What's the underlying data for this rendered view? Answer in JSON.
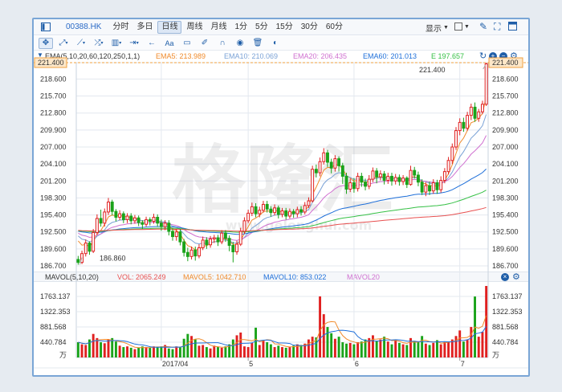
{
  "toolbar": {
    "symbol": "00388.HK",
    "periods": [
      "分时",
      "多日",
      "日线",
      "周线",
      "月线",
      "1分",
      "5分",
      "15分",
      "30分",
      "60分"
    ],
    "active_period": "日线",
    "display_label": "显示"
  },
  "price_legend": {
    "params": "EMA(5,10,20,60,120,250,1,1)",
    "ema5": "EMA5: 213.989",
    "ema10": "EMA10: 210.069",
    "ema20": "EMA20: 206.435",
    "ema60": "EMA60: 201.013",
    "ema120": "E 197.657"
  },
  "volume_legend": {
    "params": "MAVOL(5,10,20)",
    "vol": "VOL: 2065.249",
    "mavol5": "MAVOL5: 1042.710",
    "mavol10": "MAVOL10: 853.022",
    "mavol20": "MAVOL20"
  },
  "watermark": {
    "brand": "格隆汇",
    "url": "www.gelonghui.com"
  },
  "colors": {
    "up": "#e02020",
    "down": "#1aa31a",
    "ema5": "#f08a2a",
    "ema10": "#7aa2d6",
    "ema20": "#d070d0",
    "ema60": "#1e6fd9",
    "ema120": "#35c045",
    "ema250": "#e85050",
    "accent": "#1f5ea8"
  },
  "price_axis": {
    "ticks": [
      "221.400",
      "218.600",
      "215.700",
      "212.800",
      "209.900",
      "207.000",
      "204.100",
      "201.200",
      "198.300",
      "195.400",
      "192.500",
      "189.600",
      "186.700"
    ],
    "current": "221.400",
    "min": 186.7,
    "max": 221.4
  },
  "annotations": {
    "high": "221.400",
    "low": "186.860"
  },
  "volume_axis": {
    "ticks": [
      "1763.137",
      "1322.353",
      "881.568",
      "440.784"
    ],
    "unit": "万",
    "max": 2065
  },
  "date_axis": {
    "labels": [
      "2017/04",
      "5",
      "6",
      "7"
    ],
    "label_index": [
      22,
      45,
      73,
      101
    ]
  },
  "chart_data": {
    "type": "candlestick",
    "title": "",
    "ylabel": "",
    "ylim": [
      186.7,
      221.4
    ],
    "candles": [
      [
        187.8,
        187.3,
        188.4,
        186.9
      ],
      [
        187.3,
        188.8,
        189.3,
        187.0
      ],
      [
        188.8,
        190.6,
        191.2,
        188.3
      ],
      [
        190.6,
        189.2,
        190.9,
        188.6
      ],
      [
        189.2,
        192.4,
        193.0,
        188.9
      ],
      [
        192.4,
        194.8,
        195.5,
        192.0
      ],
      [
        194.8,
        194.0,
        196.3,
        193.4
      ],
      [
        194.0,
        195.9,
        196.5,
        193.4
      ],
      [
        195.9,
        197.6,
        198.3,
        195.4
      ],
      [
        197.6,
        196.0,
        198.0,
        195.3
      ],
      [
        196.0,
        195.0,
        196.4,
        194.3
      ],
      [
        195.0,
        195.6,
        196.2,
        194.5
      ],
      [
        195.6,
        194.6,
        196.0,
        194.0
      ],
      [
        194.6,
        195.2,
        195.7,
        194.0
      ],
      [
        195.2,
        194.4,
        195.7,
        193.8
      ],
      [
        194.4,
        194.9,
        195.4,
        193.9
      ],
      [
        194.9,
        194.1,
        195.3,
        193.5
      ],
      [
        194.1,
        193.8,
        194.5,
        193.0
      ],
      [
        193.8,
        194.6,
        195.1,
        193.4
      ],
      [
        194.6,
        194.3,
        195.0,
        193.6
      ],
      [
        194.3,
        195.0,
        195.6,
        193.9
      ],
      [
        195.0,
        194.0,
        195.5,
        193.4
      ],
      [
        194.0,
        193.4,
        194.6,
        192.7
      ],
      [
        193.4,
        194.0,
        194.5,
        192.8
      ],
      [
        194.0,
        192.6,
        194.5,
        191.9
      ],
      [
        192.6,
        191.7,
        193.2,
        191.0
      ],
      [
        191.7,
        192.5,
        193.0,
        191.0
      ],
      [
        192.5,
        190.8,
        193.0,
        190.2
      ],
      [
        190.8,
        189.0,
        191.3,
        188.3
      ],
      [
        189.0,
        188.3,
        189.8,
        187.5
      ],
      [
        188.3,
        189.4,
        190.0,
        187.8
      ],
      [
        189.4,
        188.4,
        190.0,
        187.6
      ],
      [
        188.4,
        189.8,
        190.4,
        188.0
      ],
      [
        189.8,
        191.1,
        191.7,
        189.4
      ],
      [
        191.1,
        190.3,
        191.6,
        189.6
      ],
      [
        190.3,
        191.3,
        191.8,
        189.8
      ],
      [
        191.3,
        191.5,
        192.0,
        190.6
      ],
      [
        191.5,
        190.8,
        192.0,
        190.1
      ],
      [
        190.8,
        192.3,
        192.8,
        190.4
      ],
      [
        192.3,
        191.4,
        192.8,
        190.8
      ],
      [
        191.4,
        190.2,
        191.9,
        189.2
      ],
      [
        190.2,
        189.1,
        190.8,
        187.3
      ],
      [
        189.1,
        190.4,
        191.0,
        188.6
      ],
      [
        190.4,
        192.6,
        193.2,
        190.1
      ],
      [
        192.6,
        194.4,
        195.0,
        192.2
      ],
      [
        194.4,
        195.7,
        196.3,
        194.0
      ],
      [
        195.7,
        196.8,
        197.5,
        195.2
      ],
      [
        196.8,
        195.6,
        197.4,
        195.0
      ],
      [
        195.6,
        196.2,
        196.8,
        195.0
      ],
      [
        196.2,
        197.2,
        197.8,
        195.8
      ],
      [
        197.2,
        196.4,
        197.8,
        195.8
      ],
      [
        196.4,
        195.8,
        196.9,
        195.1
      ],
      [
        195.8,
        196.6,
        197.2,
        195.3
      ],
      [
        196.6,
        195.5,
        197.0,
        194.8
      ],
      [
        195.5,
        196.1,
        196.6,
        195.0
      ],
      [
        196.1,
        195.2,
        196.6,
        194.6
      ],
      [
        195.2,
        196.0,
        196.5,
        194.8
      ],
      [
        196.0,
        195.6,
        196.4,
        194.9
      ],
      [
        195.6,
        196.3,
        196.8,
        195.0
      ],
      [
        196.3,
        195.9,
        196.9,
        195.3
      ],
      [
        195.9,
        197.0,
        197.6,
        195.5
      ],
      [
        197.0,
        197.8,
        198.4,
        196.6
      ],
      [
        197.8,
        203.2,
        203.8,
        197.5
      ],
      [
        203.2,
        202.6,
        204.0,
        201.8
      ],
      [
        202.6,
        204.5,
        205.2,
        202.0
      ],
      [
        204.5,
        206.0,
        206.8,
        204.0
      ],
      [
        206.0,
        204.4,
        206.5,
        203.6
      ],
      [
        204.4,
        203.4,
        205.0,
        202.5
      ],
      [
        203.4,
        205.0,
        205.6,
        202.8
      ],
      [
        205.0,
        203.8,
        205.4,
        202.8
      ],
      [
        203.8,
        202.0,
        204.3,
        200.7
      ],
      [
        202.0,
        199.8,
        202.6,
        199.0
      ],
      [
        199.8,
        200.9,
        201.6,
        199.3
      ],
      [
        200.9,
        199.9,
        201.7,
        199.2
      ],
      [
        199.9,
        202.0,
        202.6,
        199.4
      ],
      [
        202.0,
        201.0,
        202.6,
        200.2
      ],
      [
        201.0,
        200.3,
        201.6,
        199.6
      ],
      [
        200.3,
        201.5,
        202.2,
        199.8
      ],
      [
        201.5,
        202.9,
        203.5,
        201.0
      ],
      [
        202.9,
        201.9,
        203.4,
        200.8
      ],
      [
        201.9,
        202.4,
        203.0,
        201.3
      ],
      [
        202.4,
        201.3,
        202.9,
        200.6
      ],
      [
        201.3,
        202.0,
        202.6,
        200.7
      ],
      [
        202.0,
        201.2,
        202.6,
        200.4
      ],
      [
        201.2,
        201.8,
        202.4,
        200.6
      ],
      [
        201.8,
        201.1,
        202.3,
        200.4
      ],
      [
        201.1,
        201.7,
        202.2,
        200.5
      ],
      [
        201.7,
        200.6,
        202.0,
        200.0
      ],
      [
        200.6,
        203.0,
        203.8,
        200.4
      ],
      [
        203.0,
        202.2,
        203.6,
        201.6
      ],
      [
        202.2,
        201.0,
        202.8,
        200.3
      ],
      [
        201.0,
        199.3,
        201.5,
        198.8
      ],
      [
        199.3,
        200.4,
        201.0,
        198.6
      ],
      [
        200.4,
        199.5,
        201.1,
        198.8
      ],
      [
        199.5,
        200.9,
        201.5,
        199.0
      ],
      [
        200.9,
        199.7,
        201.4,
        199.0
      ],
      [
        199.7,
        201.3,
        202.0,
        199.2
      ],
      [
        201.3,
        202.8,
        203.4,
        200.8
      ],
      [
        202.8,
        204.7,
        205.3,
        202.3
      ],
      [
        204.7,
        207.0,
        207.6,
        204.1
      ],
      [
        207.0,
        209.8,
        210.4,
        206.5
      ],
      [
        209.8,
        211.2,
        211.9,
        209.0
      ],
      [
        211.2,
        210.2,
        212.0,
        209.6
      ],
      [
        210.2,
        212.4,
        213.0,
        209.8
      ],
      [
        212.4,
        213.8,
        214.4,
        211.6
      ],
      [
        213.8,
        211.9,
        214.6,
        211.3
      ],
      [
        211.9,
        213.0,
        213.5,
        211.3
      ],
      [
        213.0,
        214.3,
        214.9,
        212.6
      ],
      [
        214.3,
        221.2,
        221.4,
        214.0
      ]
    ],
    "volumes": [
      440,
      380,
      360,
      520,
      680,
      560,
      440,
      410,
      520,
      560,
      460,
      340,
      300,
      320,
      280,
      240,
      280,
      320,
      300,
      280,
      320,
      300,
      320,
      360,
      260,
      240,
      320,
      300,
      540,
      680,
      620,
      520,
      340,
      360,
      300,
      260,
      340,
      300,
      280,
      320,
      380,
      520,
      640,
      720,
      320,
      300,
      420,
      860,
      360,
      480,
      440,
      380,
      300,
      340,
      300,
      280,
      300,
      340,
      380,
      360,
      400,
      520,
      600,
      580,
      1763,
      1250,
      880,
      700,
      540,
      600,
      440,
      400,
      420,
      380,
      440,
      460,
      520,
      560,
      640,
      480,
      520,
      600,
      460,
      380,
      500,
      420,
      380,
      360,
      560,
      480,
      440,
      620,
      400,
      360,
      420,
      500,
      380,
      440,
      460,
      520,
      620,
      780,
      460,
      520,
      880,
      1760,
      600,
      740,
      2065
    ]
  }
}
